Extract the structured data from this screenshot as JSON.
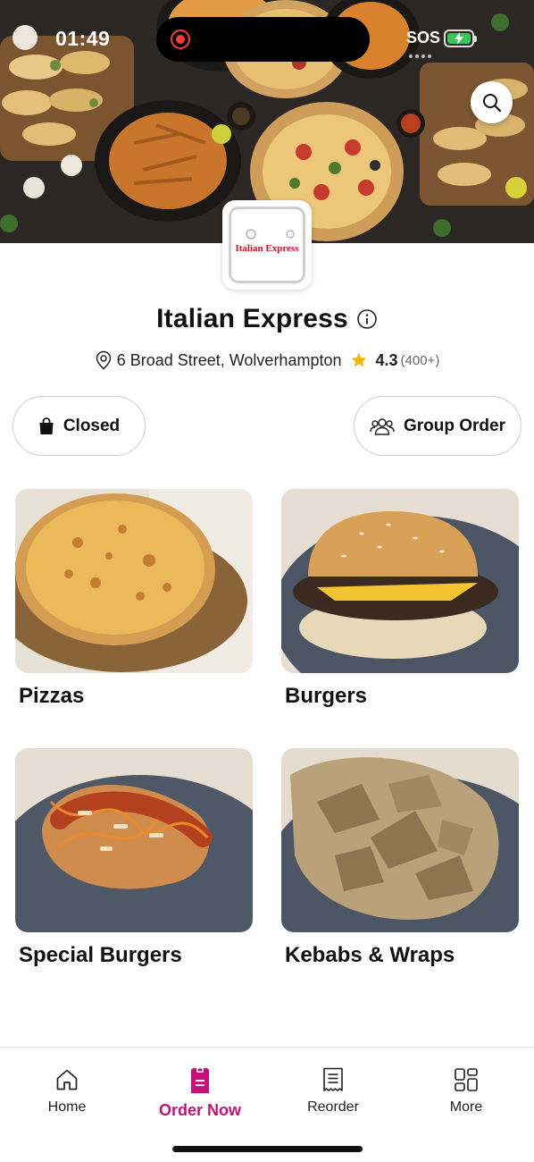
{
  "status_bar": {
    "time": "01:49",
    "sos": "SOS"
  },
  "header": {
    "search_icon": "search-icon"
  },
  "logo": {
    "text": "Italian Express"
  },
  "restaurant": {
    "name": "Italian Express",
    "address": "6 Broad Street, Wolverhampton",
    "rating": "4.3",
    "reviews": "(400+)"
  },
  "actions": {
    "closed_label": "Closed",
    "group_order_label": "Group Order"
  },
  "categories": [
    {
      "label": "Pizzas"
    },
    {
      "label": "Burgers"
    },
    {
      "label": "Special Burgers"
    },
    {
      "label": "Kebabs & Wraps"
    }
  ],
  "bottom_nav": {
    "items": [
      {
        "label": "Home",
        "icon": "home-icon"
      },
      {
        "label": "Order Now",
        "icon": "order-icon",
        "active": true
      },
      {
        "label": "Reorder",
        "icon": "receipt-icon"
      },
      {
        "label": "More",
        "icon": "grid-icon"
      }
    ]
  },
  "colors": {
    "accent": "#c8107a",
    "star": "#f5b800"
  }
}
